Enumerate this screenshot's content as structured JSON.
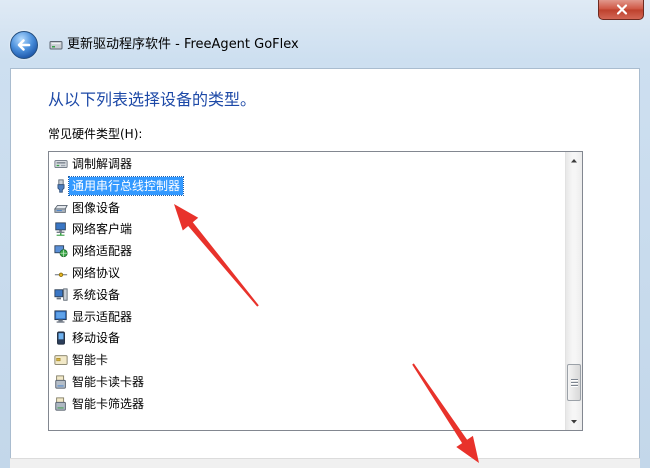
{
  "window": {
    "title": "更新驱动程序软件 - FreeAgent GoFlex",
    "close_icon": "close-icon",
    "back_icon": "back-arrow-icon",
    "title_icon": "driver-software-icon"
  },
  "main": {
    "heading": "从以下列表选择设备的类型。",
    "list_label": "常见硬件类型(H):",
    "hardware_types": [
      {
        "label": "调制解调器",
        "icon": "modem-icon",
        "selected": false
      },
      {
        "label": "通用串行总线控制器",
        "icon": "usb-controller-icon",
        "selected": true
      },
      {
        "label": "图像设备",
        "icon": "imaging-device-icon",
        "selected": false
      },
      {
        "label": "网络客户端",
        "icon": "network-client-icon",
        "selected": false
      },
      {
        "label": "网络适配器",
        "icon": "network-adapter-icon",
        "selected": false
      },
      {
        "label": "网络协议",
        "icon": "network-protocol-icon",
        "selected": false
      },
      {
        "label": "系统设备",
        "icon": "system-device-icon",
        "selected": false
      },
      {
        "label": "显示适配器",
        "icon": "display-adapter-icon",
        "selected": false
      },
      {
        "label": "移动设备",
        "icon": "mobile-device-icon",
        "selected": false
      },
      {
        "label": "智能卡",
        "icon": "smart-card-icon",
        "selected": false
      },
      {
        "label": "智能卡读卡器",
        "icon": "smart-card-reader-icon",
        "selected": false
      },
      {
        "label": "智能卡筛选器",
        "icon": "smart-card-filter-icon",
        "selected": false
      }
    ]
  },
  "colors": {
    "heading": "#1d49a7",
    "selection": "#3399ff",
    "annotation_arrow": "#e8322b",
    "close_button": "#c9442f"
  }
}
